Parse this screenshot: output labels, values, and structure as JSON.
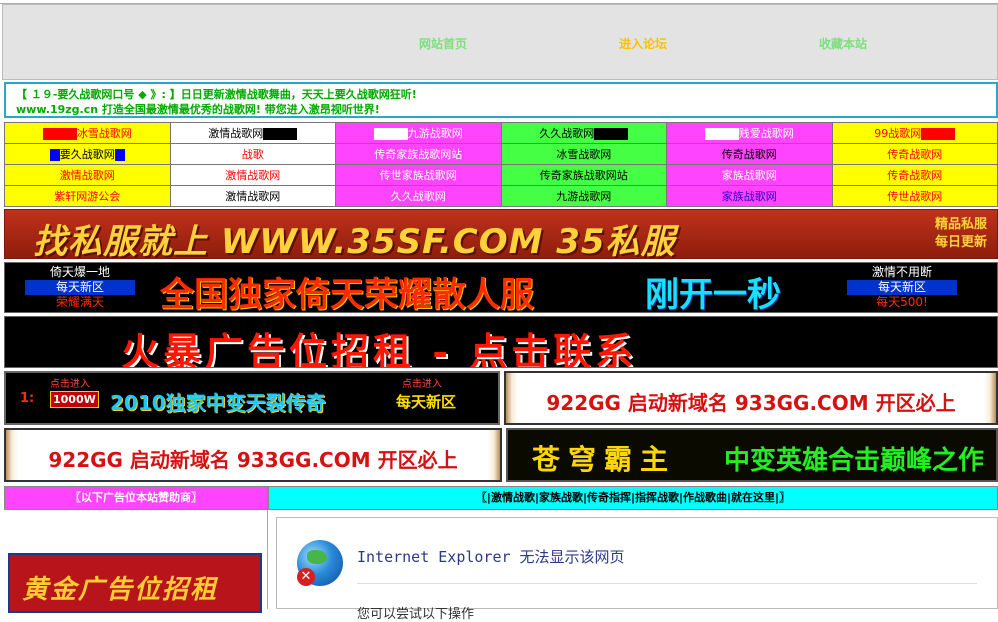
{
  "nav": {
    "home": "网站首页",
    "forum": "进入论坛",
    "bookmark": "收藏本站",
    "colors": {
      "home": "#7ddf7d",
      "forum": "#ffc000",
      "bookmark": "#7ddf7d"
    }
  },
  "slogan": {
    "line1": "【 １９-要久战歌网口号 ◆ 》: 】日日更新激情战歌舞曲，天天上要久战歌网狂听!",
    "line2": "www.19zg.cn 打造全国最激情最优秀的战歌网! 带您进入激昂视听世界!"
  },
  "link_grid": [
    [
      {
        "text": "冰雪战歌网",
        "bg": "#ffff00",
        "color": "#ff0000",
        "swatch_before": "#ff0000"
      },
      {
        "text": "激情战歌网",
        "bg": "#ffffff",
        "color": "#000000",
        "swatch_after": "#000000"
      },
      {
        "text": "九游战歌网",
        "bg": "#ff44ff",
        "color": "#ffffff",
        "swatch_before": "#ffffff"
      },
      {
        "text": "久久战歌网",
        "bg": "#44ff44",
        "color": "#000000",
        "swatch_after": "#000000"
      },
      {
        "text": "贱爱战歌网",
        "bg": "#ff44ff",
        "color": "#ffffff",
        "swatch_before": "#ffffff"
      },
      {
        "text": "99战歌网",
        "bg": "#ffff00",
        "color": "#ff0000",
        "swatch_after": "#ff0000"
      }
    ],
    [
      {
        "text": "要久战歌网",
        "bg": "#ffff00",
        "color": "#000000",
        "swatch_before": "#0000ff",
        "swatch_after": "#0000ff"
      },
      {
        "text": "战歌",
        "bg": "#ffffff",
        "color": "#ff0000"
      },
      {
        "text": "传奇家族战歌网站",
        "bg": "#ff44ff",
        "color": "#ffffff"
      },
      {
        "text": "冰雪战歌网",
        "bg": "#44ff44",
        "color": "#000000"
      },
      {
        "text": "传奇战歌网",
        "bg": "#ff44ff",
        "color": "#000000"
      },
      {
        "text": "传奇战歌网",
        "bg": "#ffff00",
        "color": "#ff0000"
      }
    ],
    [
      {
        "text": "激情战歌网",
        "bg": "#ffff00",
        "color": "#ff0000"
      },
      {
        "text": "激情战歌网",
        "bg": "#ffffff",
        "color": "#ff0000"
      },
      {
        "text": "传世家族战歌网",
        "bg": "#ff44ff",
        "color": "#ffffff"
      },
      {
        "text": "传奇家族战歌网站",
        "bg": "#44ff44",
        "color": "#000000"
      },
      {
        "text": "家族战歌网",
        "bg": "#ff44ff",
        "color": "#ffffff"
      },
      {
        "text": "传奇战歌网",
        "bg": "#ffff00",
        "color": "#ff0000"
      }
    ],
    [
      {
        "text": "紫轩网游公会",
        "bg": "#ffff00",
        "color": "#ff0000"
      },
      {
        "text": "激情战歌网",
        "bg": "#ffffff",
        "color": "#000000"
      },
      {
        "text": "久久战歌网",
        "bg": "#ff44ff",
        "color": "#ffffff"
      },
      {
        "text": "九游战歌网",
        "bg": "#44ff44",
        "color": "#000000"
      },
      {
        "text": "家族战歌网",
        "bg": "#ff44ff",
        "color": "#3300cc"
      },
      {
        "text": "传世战歌网",
        "bg": "#ffff00",
        "color": "#ff0000"
      }
    ]
  ],
  "banners": {
    "sf35": {
      "main": "找私服就上 WWW.35SF.COM 35私服",
      "side1": "精品私服",
      "side2": "每日更新"
    },
    "yitian": {
      "left1": "倚天爆一地",
      "left2": "每天新区",
      "left3": "荣耀满天",
      "main": "全国独家倚天荣耀散人服",
      "sub": "刚开一秒",
      "right1": "激情不用断",
      "right2": "每天新区",
      "right3": "每天500!"
    },
    "ad_wanted": "火暴广告位招租  -  点击联系",
    "tianlie": {
      "num": "1:",
      "tag": "1000W",
      "title": "2010独家中变天裂传奇",
      "click1": "点击进入",
      "click2": "点击进入",
      "newzone": "每天新区"
    },
    "gg922": "922GG 启动新域名 933GG.COM 开区必上",
    "cangqiong": {
      "left": "苍穹霸主",
      "right": "中变英雄合击巅峰之作"
    }
  },
  "sponsor_bar": "〖以下广告位本站赞助商〗",
  "categories_bar": "〖|激情战歌|家族战歌|传奇指挥|指挥战歌|作战歌曲|就在这里|〗",
  "gold_ad": "黄金广告位招租",
  "ie_error": {
    "title": "Internet Explorer 无法显示该网页",
    "sub": "您可以尝试以下操作"
  }
}
